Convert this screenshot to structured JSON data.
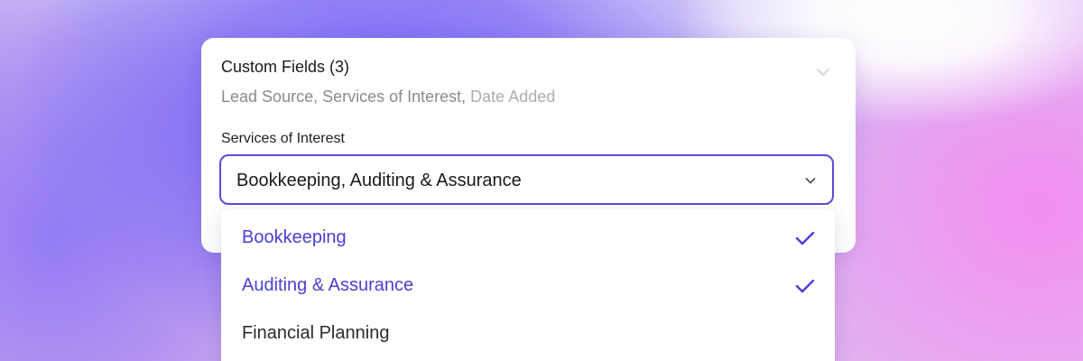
{
  "card": {
    "title": "Custom Fields (3)",
    "collapse_icon": "chevron-down-icon",
    "subtitle_main": "Lead Source, Services of Interest,",
    "subtitle_faded": "Date Added"
  },
  "field": {
    "label": "Services of Interest",
    "value": "Bookkeeping, Auditing & Assurance",
    "chevron_icon": "chevron-down-icon"
  },
  "dropdown": {
    "options": [
      {
        "label": "Bookkeeping",
        "selected": true
      },
      {
        "label": "Auditing & Assurance",
        "selected": true
      },
      {
        "label": "Financial Planning",
        "selected": false
      }
    ],
    "check_icon": "check-icon"
  },
  "colors": {
    "accent": "#5b4ae0",
    "selected_text": "#4a3fd6",
    "muted_text": "#8a8a8a",
    "chevron_faint": "#e3cfe6"
  }
}
